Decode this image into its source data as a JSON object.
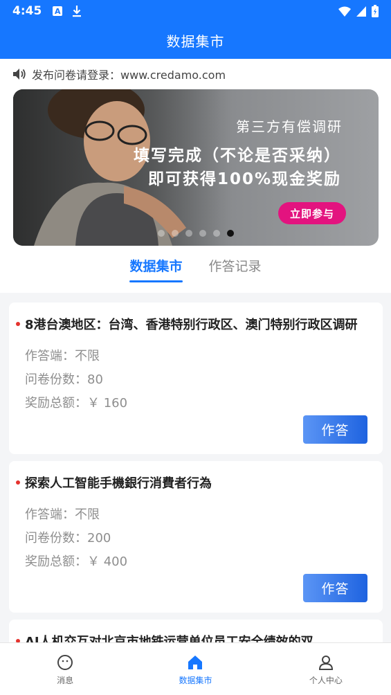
{
  "status_bar": {
    "time": "4:45"
  },
  "header": {
    "title": "数据集市"
  },
  "notice": {
    "text": "发布问卷请登录：www.credamo.com"
  },
  "banner": {
    "line1": "第三方有偿调研",
    "line2": "填写完成（不论是否采纳）",
    "line3": "即可获得100%现金奖励",
    "button": "立即参与",
    "dot_count": 6,
    "active_dot": 5
  },
  "tabs": [
    {
      "label": "数据集市",
      "active": true
    },
    {
      "label": "作答记录",
      "active": false
    }
  ],
  "cards": [
    {
      "title": "8港台澳地区：台湾、香港特别行政区、澳门特别行政区调研",
      "endpoint": "作答端：不限",
      "count": "问卷份数：80",
      "reward": "奖励总额：￥ 160",
      "button": "作答"
    },
    {
      "title": "探索人工智能手機銀行消費者行為",
      "endpoint": "作答端：不限",
      "count": "问卷份数：200",
      "reward": "奖励总额：￥ 400",
      "button": "作答"
    },
    {
      "title": "AI人机交互对北京市地铁运营单位员工安全绩效的双…"
    }
  ],
  "bottom_nav": [
    {
      "label": "消息",
      "icon": "message-face-icon",
      "active": false
    },
    {
      "label": "数据集市",
      "icon": "home-icon",
      "active": true
    },
    {
      "label": "个人中心",
      "icon": "person-icon",
      "active": false
    }
  ],
  "colors": {
    "primary": "#1677ff",
    "banner_button": "#e3137f",
    "dot_red": "#e5322d"
  }
}
